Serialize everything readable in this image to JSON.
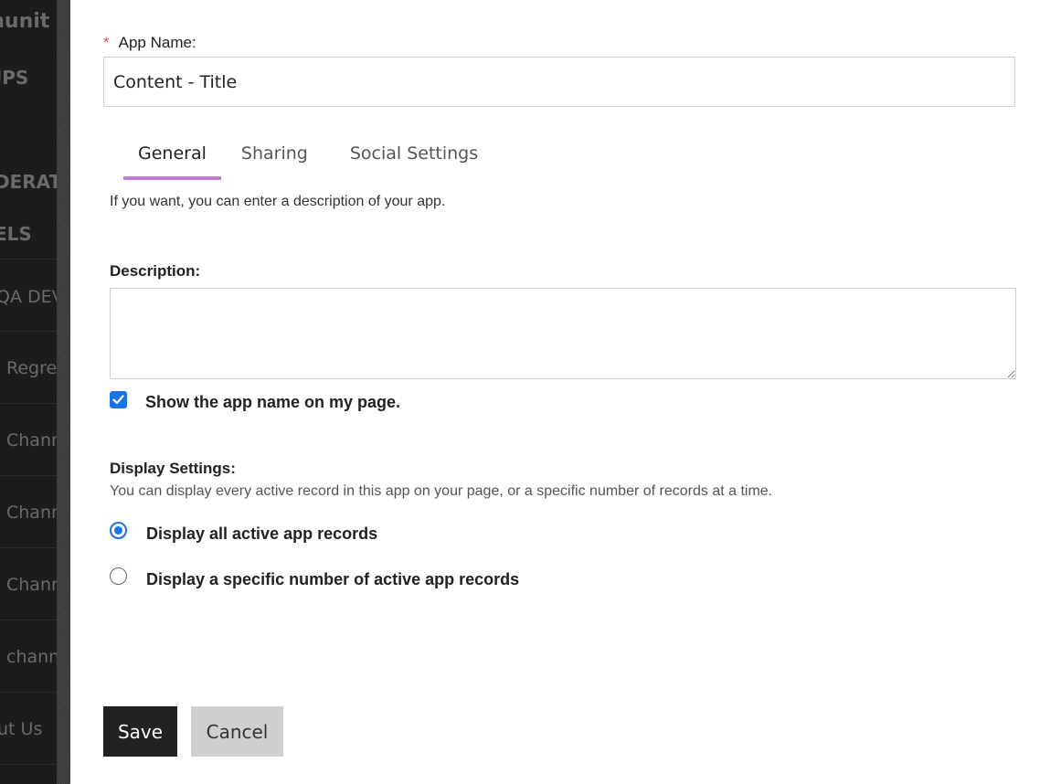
{
  "background_sidebar": {
    "items": [
      {
        "label": "munit"
      },
      {
        "label": "UPS"
      },
      {
        "label": "DERATI"
      },
      {
        "label": "ELS"
      },
      {
        "label": "QA DEV"
      },
      {
        "label": "Regre"
      },
      {
        "label": "Chann"
      },
      {
        "label": "Chann"
      },
      {
        "label": "Chann"
      },
      {
        "label": "chann"
      },
      {
        "label": "ut Us"
      }
    ]
  },
  "form": {
    "app_name_label": "App Name:",
    "required_marker": "*",
    "app_name_value": "Content - Title",
    "tabs": [
      {
        "label": "General",
        "active": true
      },
      {
        "label": "Sharing",
        "active": false
      },
      {
        "label": "Social Settings",
        "active": false
      }
    ],
    "general_hint": "If you want, you can enter a description of your app.",
    "description_label": "Description:",
    "description_value": "",
    "show_name_checkbox": {
      "label": "Show the app name on my page.",
      "checked": true
    },
    "display_settings_label": "Display Settings:",
    "display_settings_hint": "You can display every active record in this app on your page, or a specific number of records at a time.",
    "display_options": [
      {
        "label": "Display all active app records",
        "selected": true
      },
      {
        "label": "Display a specific number of active app records",
        "selected": false
      }
    ],
    "save_label": "Save",
    "cancel_label": "Cancel"
  },
  "colors": {
    "accent": "#1a73e8",
    "tab_underline": "#c17bd6",
    "required": "#d9534f",
    "save_bg": "#222222",
    "cancel_bg": "#cfcfcf"
  }
}
